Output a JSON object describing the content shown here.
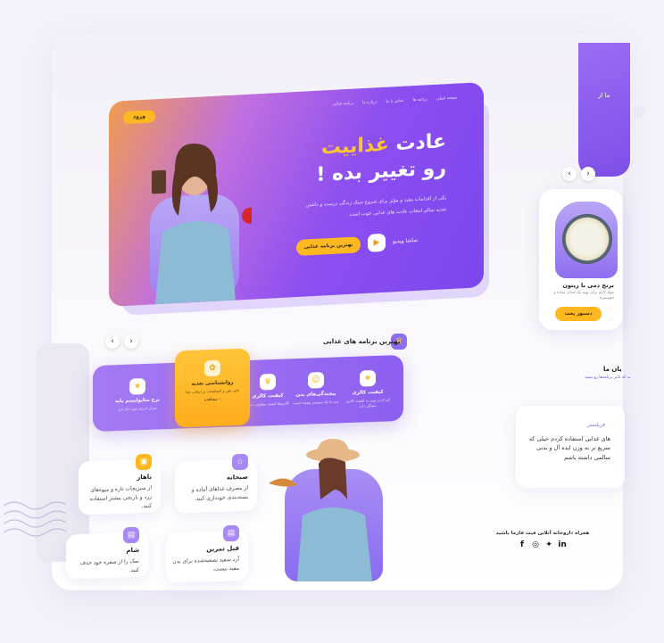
{
  "hero": {
    "login": "ورود",
    "nav": [
      "صفحه اصلی",
      "برنامه ها",
      "تماس با ما",
      "درباره ما",
      "برنامه غذایی"
    ],
    "title_prefix": "عادت",
    "title_accent": "غذاییت",
    "title_line2": "رو تغییر بده !",
    "description": "یکی از اقدامات مفید و مؤثر برای شروع سبک زندگی درست و داشتن تغذیه سالم انتخاب عادت های غذایی خوب است.",
    "cta": "بهترین برنامه غذایی",
    "play_icon": "play-icon",
    "video_label": "تماشا ویدیو"
  },
  "programs": {
    "title": "بهترین برنامه های غذایی",
    "prev": "‹",
    "next": "›",
    "items": [
      {
        "title": "کیفیت کالری",
        "desc": "کم کردن وزن به کیفیت کالری بستگی دارد"
      },
      {
        "title": "پیچیدگی‌های بدن",
        "desc": "بدن ما یک سیستم پیچیده است"
      },
      {
        "title": "کیفیت کالری",
        "desc": "کالری‌ها کیفیت متفاوتی دارند"
      },
      {
        "title": "نرخ متابولیسم پایه",
        "desc": "میزان انرژی مورد نیاز بدن"
      }
    ],
    "active": {
      "title": "روانشناسی تغذیه",
      "desc": "تاثیر ذهن و احساسات بر انتخاب غذا",
      "link": "مشاهده ‹"
    }
  },
  "meals": [
    {
      "title": "ناهار",
      "desc": "از سبزیجات تازه و میوه‌های زرد و نارنجی بیشتر استفاده کنید."
    },
    {
      "title": "صبحانه",
      "desc": "از مصرف غذاهای آماده و بسته‌بندی خودداری کنید."
    },
    {
      "title": "شام",
      "desc": "نمک را از سفره خود حذف کنید."
    },
    {
      "title": "قبل تمرین",
      "desc": "آرد سفید تصفیه‌شده برای بدن مفید نیست."
    }
  ],
  "side": {
    "food_title": "برنج دمی با زیتون",
    "food_desc": "مواد لازم برای تهیه یک غذای ساده و خوشمزه",
    "food_btn": "دستور پخت",
    "heading": "یان ما",
    "sub": "ید که تاثیر برنامه‌ها رو ببینید",
    "t_name": "فریلنسر",
    "t_text": "های غذایی استفاده کردم خیلی که سریع تر به وزن ایده آل و بدنی سالمی داشته باشم",
    "top_card_text": "ما از",
    "footer": "همراه داروخانه آنلاین فیت فارما باشید"
  },
  "colors": {
    "purple": "#8d5ff0",
    "orange": "#ffb81f"
  }
}
